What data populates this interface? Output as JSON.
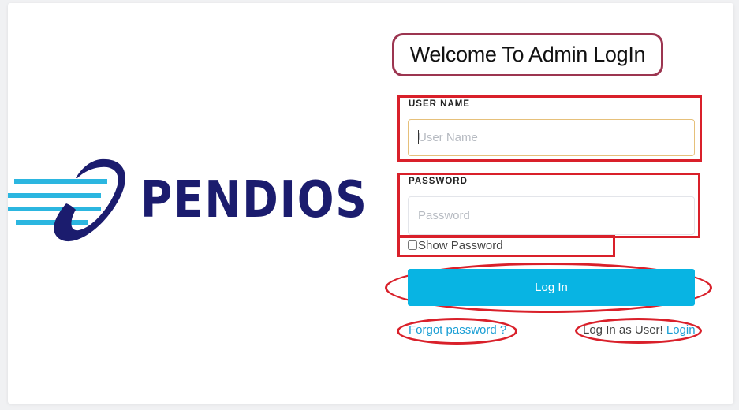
{
  "brand": {
    "name": "PENDIOS",
    "primary_color": "#1b1c6e",
    "accent_color": "#2bb6e0"
  },
  "login_form": {
    "title": "Welcome To Admin LogIn",
    "username": {
      "label": "USER NAME",
      "placeholder": "User Name",
      "value": ""
    },
    "password": {
      "label": "PASSWORD",
      "placeholder": "Password",
      "value": ""
    },
    "show_password": {
      "label": "Show Password",
      "checked": false
    },
    "submit_label": "Log In",
    "forgot_password": "Forgot password ?",
    "user_login_prompt": "Log In as User!",
    "user_login_link": "Login",
    "button_color": "#08b4e3",
    "annotation_color": "#d9202a"
  }
}
